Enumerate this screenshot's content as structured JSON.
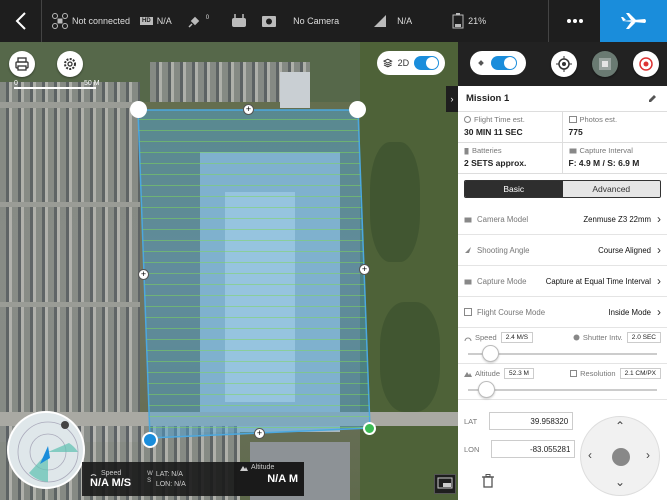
{
  "topbar": {
    "back_icon": "chevron-left-icon",
    "connection": "Not connected",
    "hd_badge": "HD",
    "hd_value": "N/A",
    "satellite_count": "0",
    "camera": "No Camera",
    "signal_value": "N/A",
    "battery_percent": "21%",
    "fly_icon": "airplane-icon",
    "accent": "#1a8ddb"
  },
  "map": {
    "scale_start": "0",
    "scale_end": "50 M",
    "mode_label": "2D",
    "grid_color": "#7ed957",
    "area_color": "#4ba8e0"
  },
  "mission": {
    "title": "Mission 1",
    "flight_time_label": "Flight Time est.",
    "flight_time_value": "30 MIN 11 SEC",
    "photos_label": "Photos est.",
    "photos_value": "775",
    "batteries_label": "Batteries",
    "batteries_value": "2 SETS approx.",
    "capture_interval_label": "Capture Interval",
    "capture_interval_value": "F: 4.9 M / S: 6.9 M",
    "tabs": [
      "Basic",
      "Advanced"
    ],
    "rows": [
      {
        "label": "Camera Model",
        "value": "Zenmuse Z3 22mm"
      },
      {
        "label": "Shooting Angle",
        "value": "Course Aligned"
      },
      {
        "label": "Capture Mode",
        "value": "Capture at Equal Time Interval"
      },
      {
        "label": "Flight Course Mode",
        "value": "Inside Mode"
      }
    ],
    "speed_label": "Speed",
    "speed_value": "2.4 M/S",
    "speed_level": 0.1,
    "shutter_label": "Shutter Intv.",
    "shutter_value": "2.0 SEC",
    "altitude_label": "Altitude",
    "altitude_value": "52.3 M",
    "altitude_level": 0.08,
    "resolution_label": "Resolution",
    "resolution_value": "2.1 CM/PX",
    "lat_label": "LAT",
    "lat_value": "39.958320",
    "lon_label": "LON",
    "lon_value": "-83.055281"
  },
  "hud": {
    "speed_label": "Speed",
    "speed_value": "N/A M/S",
    "lat_text": "LAT: N/A",
    "lon_text": "LON: N/A",
    "altitude_label": "Altitude",
    "altitude_value": "N/A M",
    "compass_w": "W",
    "compass_s": "S"
  }
}
